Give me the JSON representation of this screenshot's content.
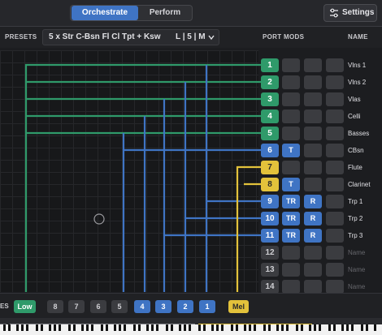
{
  "tabs": {
    "orchestrate": "Orchestrate",
    "perform": "Perform"
  },
  "settings_label": "Settings",
  "presets": {
    "label": "PRESETS",
    "name": "5 x Str C-Bsn Fl Cl Tpt + Ksw",
    "mode": "L | 5 | M"
  },
  "headers": {
    "port": "PORT",
    "mods": "MODS",
    "name": "NAME"
  },
  "colors": {
    "green": "#2f9a6a",
    "blue": "#3f74c4",
    "yellow": "#e3c23b"
  },
  "rows": [
    {
      "port": "1",
      "mods": [
        "",
        "",
        ""
      ],
      "name": "Vlns 1"
    },
    {
      "port": "2",
      "mods": [
        "",
        "",
        ""
      ],
      "name": "Vlns 2"
    },
    {
      "port": "3",
      "mods": [
        "",
        "",
        ""
      ],
      "name": "Vlas"
    },
    {
      "port": "4",
      "mods": [
        "",
        "",
        ""
      ],
      "name": "Celli"
    },
    {
      "port": "5",
      "mods": [
        "",
        "",
        ""
      ],
      "name": "Basses"
    },
    {
      "port": "6",
      "mods": [
        "T",
        "",
        ""
      ],
      "name": "CBsn"
    },
    {
      "port": "7",
      "mods": [
        "",
        "",
        ""
      ],
      "name": "Flute"
    },
    {
      "port": "8",
      "mods": [
        "T",
        "",
        ""
      ],
      "name": "Clarinet"
    },
    {
      "port": "9",
      "mods": [
        "TR",
        "R",
        ""
      ],
      "name": "Trp 1"
    },
    {
      "port": "10",
      "mods": [
        "TR",
        "R",
        ""
      ],
      "name": "Trp 2"
    },
    {
      "port": "11",
      "mods": [
        "TR",
        "R",
        ""
      ],
      "name": "Trp 3"
    },
    {
      "port": "12",
      "mods": [
        "",
        "",
        ""
      ],
      "name": "Name"
    },
    {
      "port": "13",
      "mods": [
        "",
        "",
        ""
      ],
      "name": "Name"
    },
    {
      "port": "14",
      "mods": [
        "",
        "",
        ""
      ],
      "name": "Name"
    }
  ],
  "bottom": {
    "label": "ES",
    "chips": [
      "Low",
      "8",
      "7",
      "6",
      "5",
      "4",
      "3",
      "2",
      "1",
      "Mel"
    ]
  }
}
